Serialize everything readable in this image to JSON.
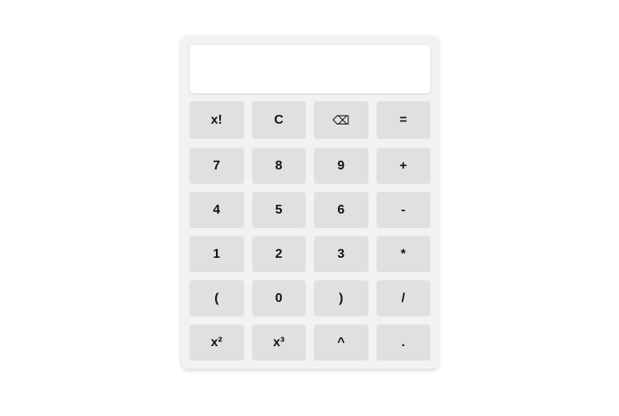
{
  "display": {
    "value": ""
  },
  "keys": [
    [
      "x!",
      "C",
      "⌫",
      "="
    ],
    [
      "7",
      "8",
      "9",
      "+"
    ],
    [
      "4",
      "5",
      "6",
      "-"
    ],
    [
      "1",
      "2",
      "3",
      "*"
    ],
    [
      "(",
      "0",
      ")",
      "/"
    ],
    [
      "x²",
      "x³",
      "^",
      "."
    ]
  ],
  "key_names": [
    [
      "factorial-button",
      "clear-button",
      "backspace-button",
      "equals-button"
    ],
    [
      "digit-7-button",
      "digit-8-button",
      "digit-9-button",
      "plus-button"
    ],
    [
      "digit-4-button",
      "digit-5-button",
      "digit-6-button",
      "minus-button"
    ],
    [
      "digit-1-button",
      "digit-2-button",
      "digit-3-button",
      "multiply-button"
    ],
    [
      "open-paren-button",
      "digit-0-button",
      "close-paren-button",
      "divide-button"
    ],
    [
      "square-button",
      "cube-button",
      "power-button",
      "decimal-point-button"
    ]
  ]
}
